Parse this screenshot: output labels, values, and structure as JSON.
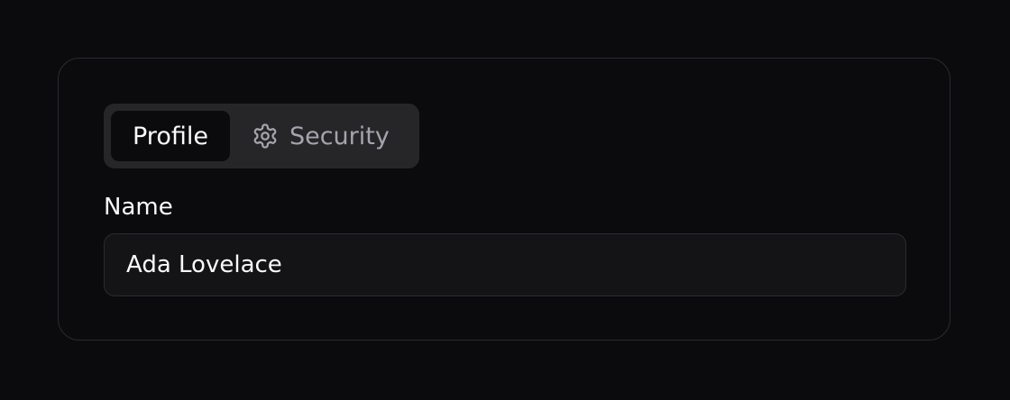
{
  "tabs": [
    {
      "label": "Profile",
      "active": true
    },
    {
      "label": "Security",
      "active": false,
      "icon": "gear-icon"
    }
  ],
  "form": {
    "name_label": "Name",
    "name_value": "Ada Lovelace"
  },
  "colors": {
    "background": "#0b0b0d",
    "card_border": "#2b2b30",
    "tab_bar": "#262629",
    "text_primary": "#fafafa",
    "text_muted": "#a4a4ac"
  }
}
